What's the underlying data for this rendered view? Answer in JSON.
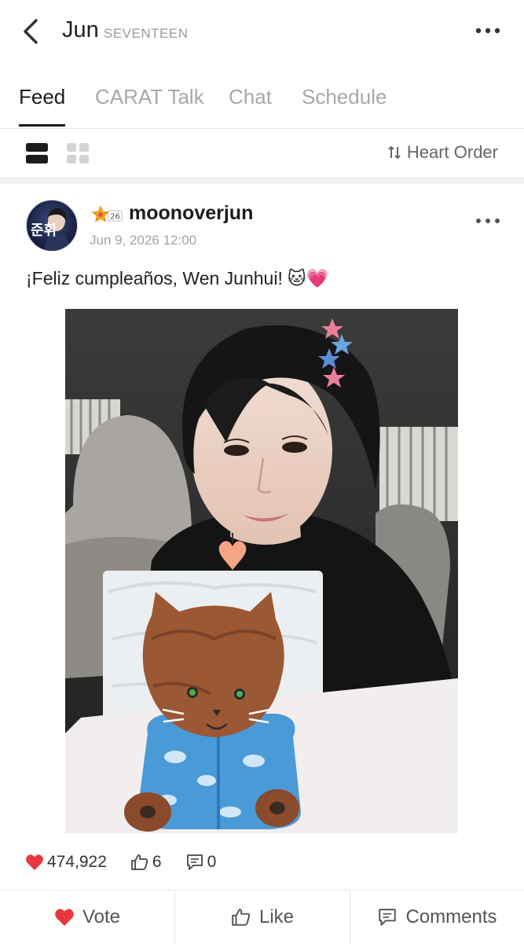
{
  "header": {
    "title": "Jun",
    "subtitle": "SEVENTEEN",
    "back_icon": "chevron-left-icon",
    "more_icon": "more-horizontal-icon"
  },
  "tabs": [
    {
      "label": "Feed",
      "active": true
    },
    {
      "label": "CARAT Talk",
      "active": false
    },
    {
      "label": "Chat",
      "active": false
    },
    {
      "label": "Schedule",
      "active": false
    }
  ],
  "viewbar": {
    "sort_label": "Heart Order",
    "sort_icon": "sort-icon"
  },
  "post": {
    "username": "moonoverjun",
    "badge_number": "26",
    "date": "Jun 9, 2026 12:00",
    "text": "¡Feliz cumpleaños, Wen Junhui!",
    "emoji": "🐱💗",
    "avatar_text": "준휘",
    "stats": {
      "hearts": "474,922",
      "likes": "6",
      "comments": "0"
    }
  },
  "actions": {
    "vote": "Vote",
    "like": "Like",
    "comments": "Comments"
  },
  "colors": {
    "heart": "#e8383d",
    "accent": "#1c1c1c"
  }
}
